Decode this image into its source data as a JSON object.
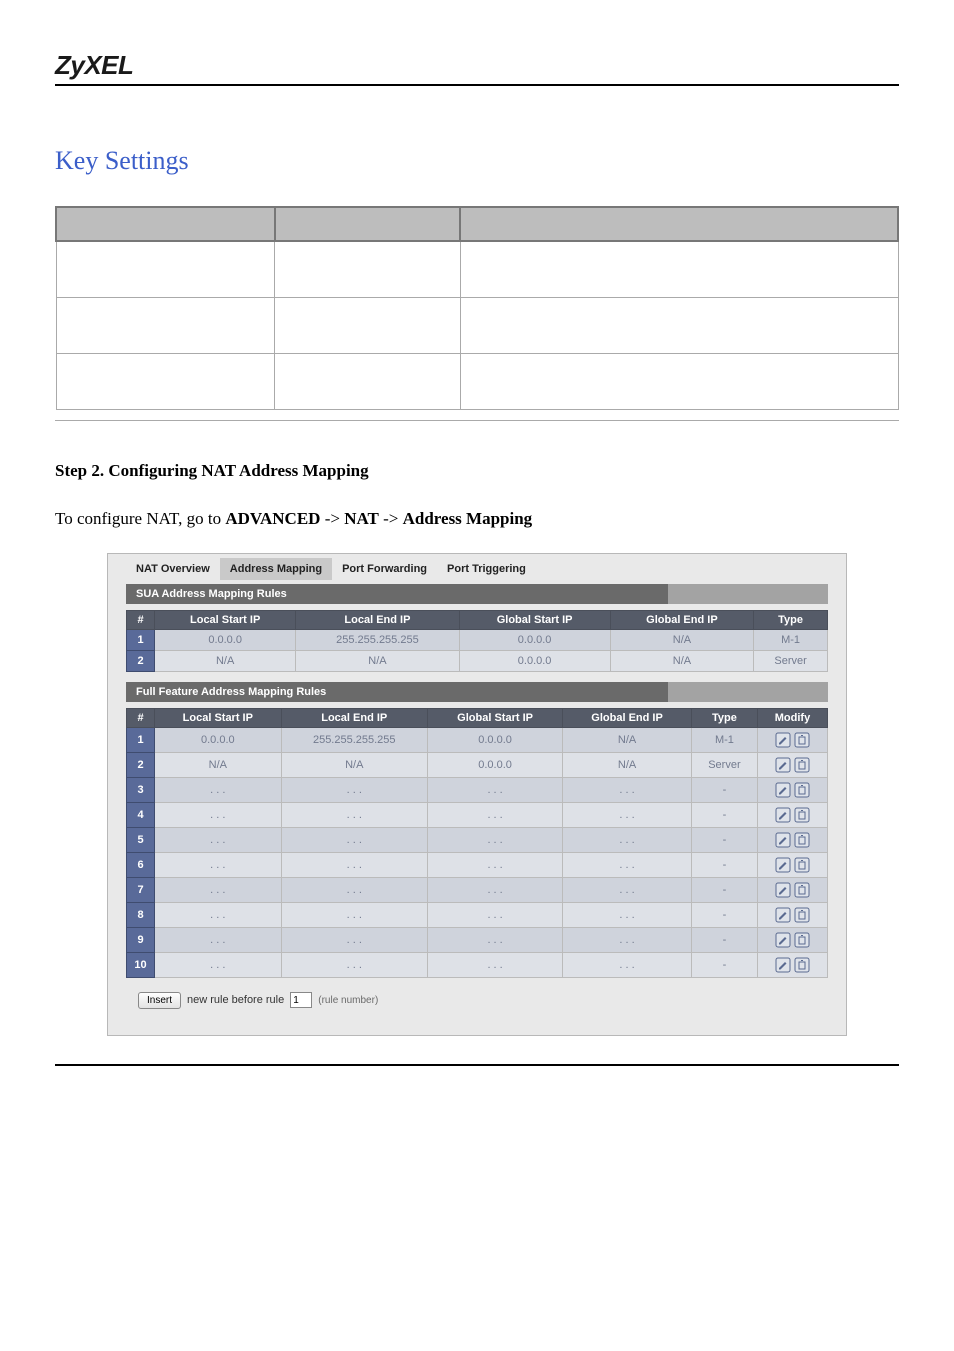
{
  "header": {
    "logo": "ZyXEL"
  },
  "sectionTitle": "Key Settings",
  "stepTitle": "Step 2. Configuring NAT Address Mapping",
  "navText": {
    "prefix": "To configure NAT, go to ",
    "b1": "ADVANCED",
    "arrow1": " -> ",
    "b2": "NAT",
    "arrow2": " -> ",
    "b3": "Address Mapping"
  },
  "tabs": [
    {
      "label": "NAT Overview",
      "active": false
    },
    {
      "label": "Address Mapping",
      "active": true
    },
    {
      "label": "Port Forwarding",
      "active": false
    },
    {
      "label": "Port Triggering",
      "active": false
    }
  ],
  "suaSection": {
    "title": "SUA Address Mapping Rules",
    "headers": [
      "#",
      "Local Start IP",
      "Local End IP",
      "Global Start IP",
      "Global End IP",
      "Type"
    ],
    "rows": [
      {
        "n": "1",
        "cells": [
          "0.0.0.0",
          "255.255.255.255",
          "0.0.0.0",
          "N/A",
          "M-1"
        ]
      },
      {
        "n": "2",
        "cells": [
          "N/A",
          "N/A",
          "0.0.0.0",
          "N/A",
          "Server"
        ]
      }
    ]
  },
  "fullSection": {
    "title": "Full Feature Address Mapping Rules",
    "headers": [
      "#",
      "Local Start IP",
      "Local End IP",
      "Global Start IP",
      "Global End IP",
      "Type",
      "Modify"
    ],
    "rows": [
      {
        "n": "1",
        "cells": [
          "0.0.0.0",
          "255.255.255.255",
          "0.0.0.0",
          "N/A",
          "M-1"
        ]
      },
      {
        "n": "2",
        "cells": [
          "N/A",
          "N/A",
          "0.0.0.0",
          "N/A",
          "Server"
        ]
      },
      {
        "n": "3",
        "cells": [
          ". . .",
          ". . .",
          ". . .",
          ". . .",
          "-"
        ]
      },
      {
        "n": "4",
        "cells": [
          ". . .",
          ". . .",
          ". . .",
          ". . .",
          "-"
        ]
      },
      {
        "n": "5",
        "cells": [
          ". . .",
          ". . .",
          ". . .",
          ". . .",
          "-"
        ]
      },
      {
        "n": "6",
        "cells": [
          ". . .",
          ". . .",
          ". . .",
          ". . .",
          "-"
        ]
      },
      {
        "n": "7",
        "cells": [
          ". . .",
          ". . .",
          ". . .",
          ". . .",
          "-"
        ]
      },
      {
        "n": "8",
        "cells": [
          ". . .",
          ". . .",
          ". . .",
          ". . .",
          "-"
        ]
      },
      {
        "n": "9",
        "cells": [
          ". . .",
          ". . .",
          ". . .",
          ". . .",
          "-"
        ]
      },
      {
        "n": "10",
        "cells": [
          ". . .",
          ". . .",
          ". . .",
          ". . .",
          "-"
        ]
      }
    ]
  },
  "insert": {
    "button": "Insert",
    "textA": "new rule before rule",
    "value": "1",
    "textB": "(rule number)"
  }
}
